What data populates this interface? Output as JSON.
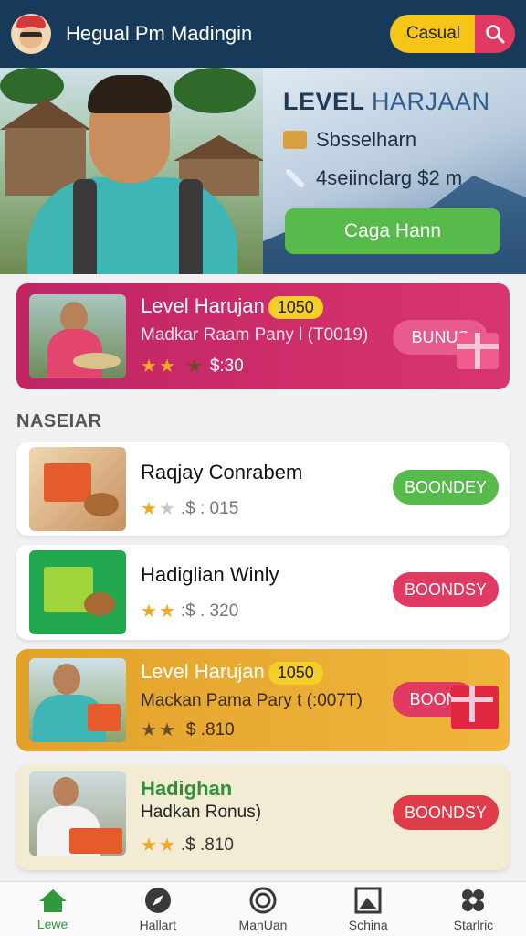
{
  "header": {
    "title": "Hegual Pm Madingin",
    "casual_label": "Casual",
    "search_icon": "search-icon"
  },
  "hero": {
    "level_word": "LEVEL",
    "level_name": "HARJAAN",
    "row1": "Sbsselharn",
    "row2": "4seiinclarg $2 m",
    "cta": "Caga Hann"
  },
  "featured": {
    "title": "Level Harujan",
    "badge": "1050",
    "subtitle": "Madkar Raam Pany l  (T0019)",
    "price": "$:30",
    "button": "BUNUS"
  },
  "section_label": "NASEIAR",
  "items": [
    {
      "title": "Raqjay Conrabem",
      "price": ".$ : 015",
      "button": "BOONDEY",
      "button_color": "#56bb4a"
    },
    {
      "title": "Hadiglian Winly",
      "price": ":$ . 320",
      "button": "BOONDSY",
      "button_color": "#e13a62"
    }
  ],
  "promo": {
    "title": "Level Harujan",
    "badge": "1050",
    "subtitle": "Mackan Pama Pary t  (:007T)",
    "price": "$ .810",
    "button": "BOON"
  },
  "last": {
    "title": "Hadighan",
    "subtitle": "Hadkan Ronus)",
    "price": ".$ .810",
    "button": "BOONDSY"
  },
  "nav": [
    {
      "label": "Lewe",
      "icon": "home-icon"
    },
    {
      "label": "Hallart",
      "icon": "compass-icon"
    },
    {
      "label": "ManUan",
      "icon": "target-icon"
    },
    {
      "label": "Schina",
      "icon": "gallery-icon"
    },
    {
      "label": "Starlric",
      "icon": "settings-icon"
    }
  ],
  "colors": {
    "header_bg": "#173a5a",
    "accent_yellow": "#f5c518",
    "accent_pink": "#e13a62",
    "accent_green": "#56bb4a",
    "featured_bg": "#c42a6c",
    "promo_bg": "#e8a932",
    "last_bg": "#f3ecd4"
  }
}
